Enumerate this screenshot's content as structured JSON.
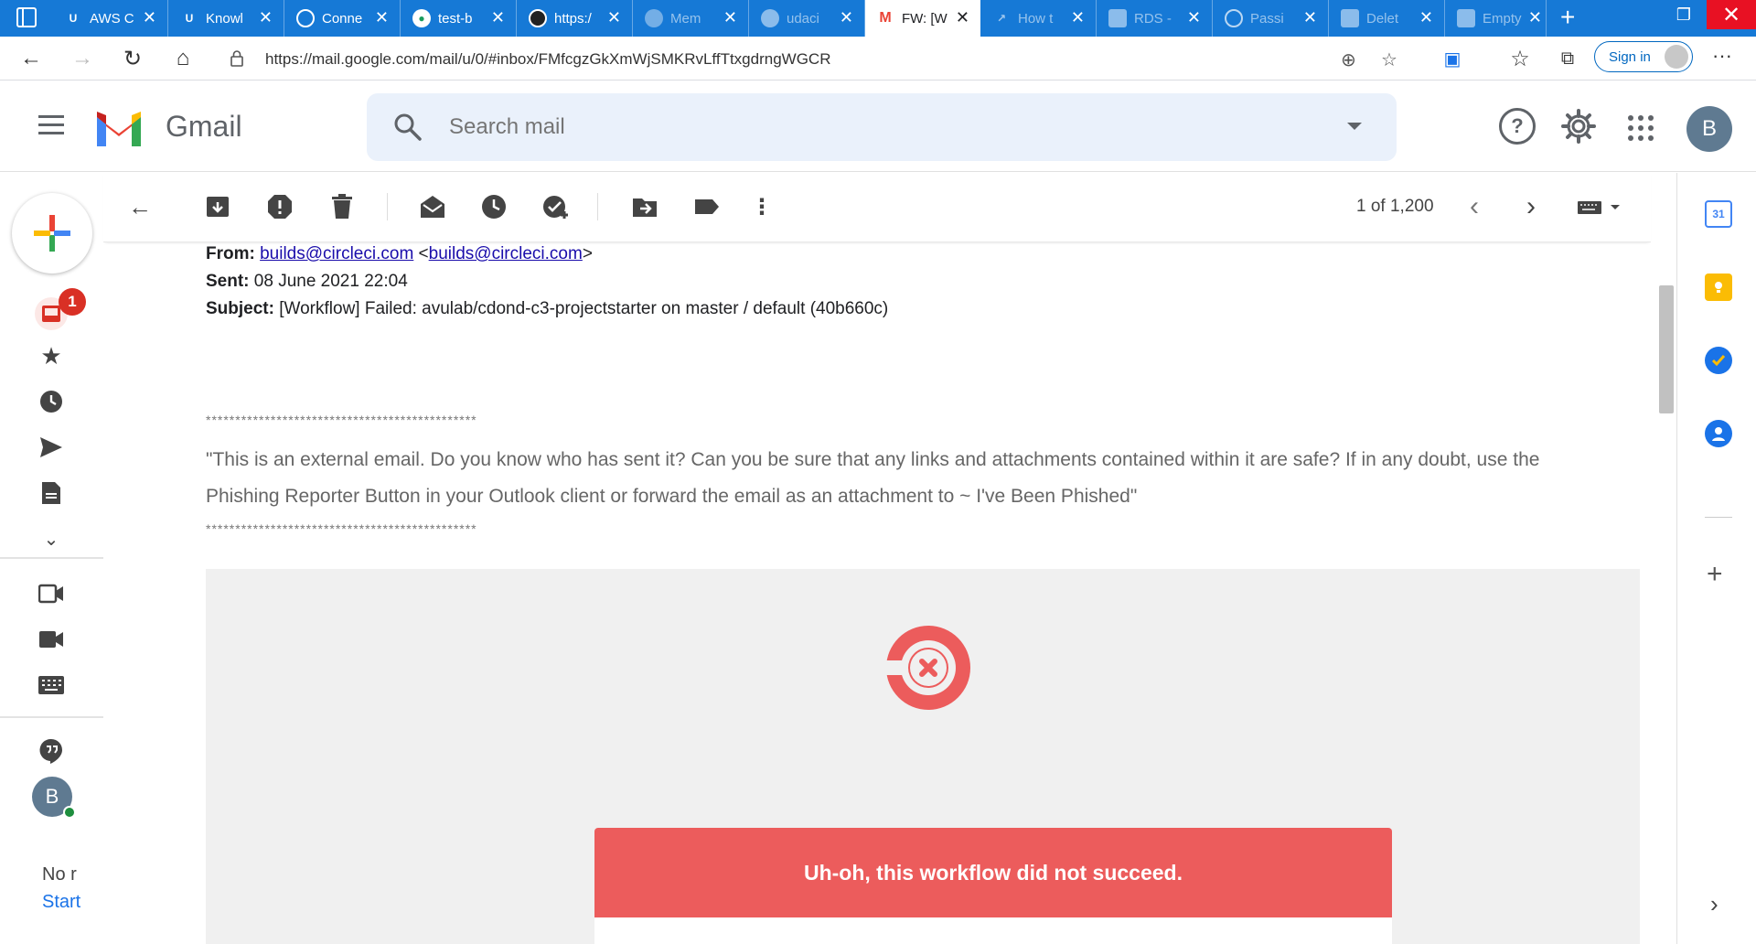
{
  "browser": {
    "tabs": [
      {
        "title": "AWS C",
        "state": "normal"
      },
      {
        "title": "Knowl",
        "state": "normal"
      },
      {
        "title": "Conne",
        "state": "normal"
      },
      {
        "title": "test-b",
        "state": "normal"
      },
      {
        "title": "https:/",
        "state": "normal"
      },
      {
        "title": "Mem",
        "state": "dim"
      },
      {
        "title": "udaci",
        "state": "dim"
      },
      {
        "title": "FW: [W",
        "state": "active"
      },
      {
        "title": "How t",
        "state": "dim"
      },
      {
        "title": "RDS -",
        "state": "dim"
      },
      {
        "title": "Passi",
        "state": "dim"
      },
      {
        "title": "Delet",
        "state": "dim"
      },
      {
        "title": "Empty",
        "state": "dim"
      }
    ],
    "url": "https://mail.google.com/mail/u/0/#inbox/FMfcgzGkXmWjSMKRvLffTtxgdrngWGCR",
    "sign_in": "Sign in",
    "ext_badge": "0"
  },
  "gmail": {
    "brand": "Gmail",
    "search_placeholder": "Search mail",
    "help_glyph": "?",
    "avatar_initial": "B",
    "inbox_badge": "1",
    "rail_text_1": "No r",
    "rail_link": "Start"
  },
  "toolbar": {
    "pager": "1 of 1,200"
  },
  "message": {
    "from_label": "From:",
    "from_name": "builds@circleci.com",
    "from_email": "builds@circleci.com",
    "sent_label": "Sent:",
    "sent_value": "08 June 2021 22:04",
    "subject_label": "Subject:",
    "subject_value": "[Workflow] Failed: avulab/cdond-c3-projectstarter on master / default (40b660c)",
    "stars": "**********************************************",
    "notice": "\"This is an external email. Do you know who has sent it? Can you be sure that any links and attachments contained within it are safe? If in any doubt, use the Phishing Reporter Button in your Outlook client or forward the email as an attachment to ~ I've Been Phished\"",
    "alert": "Uh-oh, this workflow did not succeed."
  },
  "side_panel": {
    "calendar_day": "31"
  },
  "colors": {
    "browser_tabstrip": "#1679d6",
    "gmail_red": "#ea4335",
    "circleci_red": "#ec5c5c",
    "search_bg": "#eaf1fb"
  }
}
